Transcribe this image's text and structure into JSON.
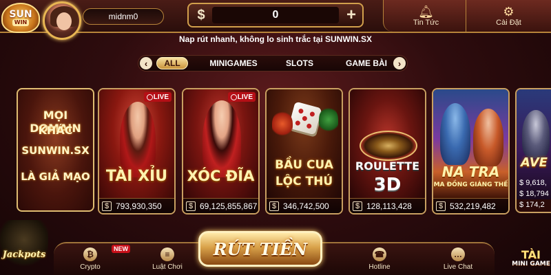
{
  "header": {
    "logo_line1": "SUN",
    "logo_line2": "WIN",
    "username": "midnm0",
    "balance": "0",
    "balance_currency_symbol": "$",
    "add_symbol": "+",
    "news_label": "Tin Tức",
    "settings_label": "Cài Đặt"
  },
  "promo_text": "Nap rút nhanh, không lo sinh trắc tại SUNWIN.SX",
  "tabs": [
    {
      "label": "ALL",
      "active": true
    },
    {
      "label": "MINIGAMES",
      "active": false
    },
    {
      "label": "SLOTS",
      "active": false
    },
    {
      "label": "GAME BÀI",
      "active": false
    }
  ],
  "cards": {
    "notice": {
      "line1": "MỌI DOMAIN",
      "line2": "KHÁC",
      "line3": "SUNWIN.SX",
      "line4": "LÀ GIẢ MẠO"
    },
    "taixiu": {
      "title": "TÀI XỈU",
      "badge": "LIVE",
      "jackpot": "793,930,350"
    },
    "xocdia": {
      "title": "XÓC ĐĨA",
      "badge": "LIVE",
      "jackpot": "69,125,855,867"
    },
    "baucua": {
      "title1": "BẦU CUA",
      "title2": "LỘC THÚ",
      "jackpot": "346,742,500"
    },
    "roulette": {
      "title1": "ROULETTE",
      "title2": "3D",
      "jackpot": "128,113,428"
    },
    "natra": {
      "title1": "NA TRA",
      "title2": "MA ĐỒNG GIÁNG THẾ",
      "jackpot": "532,219,482"
    },
    "avengers": {
      "title": "AVE",
      "values": [
        "9,618,",
        "18,794",
        "174,2"
      ]
    }
  },
  "bottom": {
    "jackpots_label": "Jackpots",
    "crypto_label": "Crypto",
    "new_badge": "NEW",
    "rules_label": "Luật Chơi",
    "withdraw_label": "RÚT TIỀN",
    "hotline_label": "Hotline",
    "livechat_label": "Live Chat",
    "taixiu_mini_line1": "TÀI",
    "taixiu_mini_line2": "MINI GAME"
  },
  "colors": {
    "accent_gold": "#d2a04c",
    "live_red": "#b50f16",
    "background": "#2e0c0e"
  }
}
